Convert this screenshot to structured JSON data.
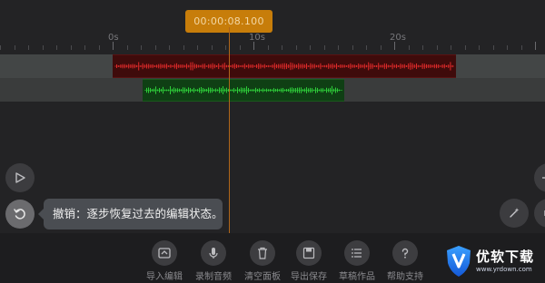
{
  "timeline": {
    "current_time": "00:00:08.100",
    "ruler_labels": [
      "0s",
      "10s",
      "20s"
    ]
  },
  "tooltip": {
    "text": "撤销：逐步恢复过去的编辑状态。"
  },
  "controls": {
    "play_icon": "play-icon",
    "undo_icon": "undo-icon",
    "magic_icon": "magic-wand-icon",
    "arrow_icon": "arrow-icon"
  },
  "toolbar": {
    "items": [
      {
        "label": "导入编辑",
        "icon": "import-icon"
      },
      {
        "label": "录制音频",
        "icon": "microphone-icon"
      },
      {
        "label": "清空面板",
        "icon": "trash-icon"
      },
      {
        "label": "导出保存",
        "icon": "save-icon"
      },
      {
        "label": "草稿作品",
        "icon": "list-icon"
      },
      {
        "label": "帮助支持",
        "icon": "help-icon"
      }
    ]
  },
  "watermark": {
    "brand": "优软下载",
    "url": "www.yrdown.com"
  },
  "colors": {
    "playhead": "#b0661a",
    "time_badge": "#c77d0a",
    "track_red": "#e02a2a",
    "track_green": "#2ed13a"
  }
}
